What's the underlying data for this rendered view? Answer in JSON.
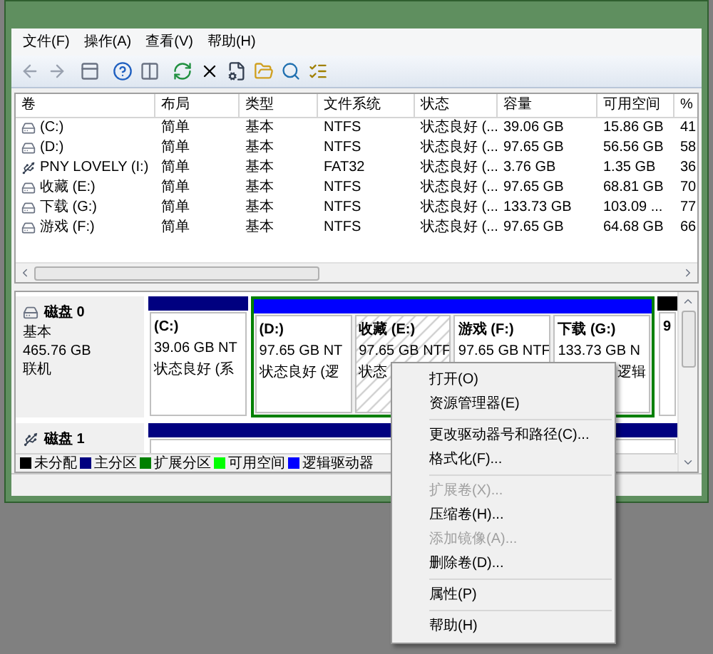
{
  "menu_bar": [
    {
      "label": "文件(F)"
    },
    {
      "label": "操作(A)"
    },
    {
      "label": "查看(V)"
    },
    {
      "label": "帮助(H)"
    }
  ],
  "volume_table": {
    "columns": [
      "卷",
      "布局",
      "类型",
      "文件系统",
      "状态",
      "容量",
      "可用空间",
      "%"
    ],
    "rows": [
      {
        "kind": "disk",
        "cells": [
          "(C:)",
          "简单",
          "基本",
          "NTFS",
          "状态良好 (...",
          "39.06 GB",
          "15.86 GB",
          "41"
        ]
      },
      {
        "kind": "disk",
        "cells": [
          "(D:)",
          "简单",
          "基本",
          "NTFS",
          "状态良好 (...",
          "97.65 GB",
          "56.56 GB",
          "58"
        ]
      },
      {
        "kind": "usb",
        "cells": [
          "PNY LOVELY (I:)",
          "简单",
          "基本",
          "FAT32",
          "状态良好 (...",
          "3.76 GB",
          "1.35 GB",
          "36"
        ]
      },
      {
        "kind": "disk",
        "cells": [
          "收藏 (E:)",
          "简单",
          "基本",
          "NTFS",
          "状态良好 (...",
          "97.65 GB",
          "68.81 GB",
          "70"
        ]
      },
      {
        "kind": "disk",
        "cells": [
          "下载 (G:)",
          "简单",
          "基本",
          "NTFS",
          "状态良好 (...",
          "133.73 GB",
          "103.09 ...",
          "77"
        ]
      },
      {
        "kind": "disk",
        "cells": [
          "游戏 (F:)",
          "简单",
          "基本",
          "NTFS",
          "状态良好 (...",
          "97.65 GB",
          "64.68 GB",
          "66"
        ]
      }
    ]
  },
  "disks": [
    {
      "name": "磁盘 0",
      "kind": "fixed",
      "type": "基本",
      "size": "465.76 GB",
      "status": "联机",
      "segments": [
        {
          "kind": "primary",
          "selected": false,
          "lines": [
            "(C:)",
            "39.06 GB NT",
            "状态良好 (系"
          ]
        },
        {
          "kind": "extended",
          "children": [
            {
              "kind": "logical",
              "selected": false,
              "lines": [
                "(D:)",
                "97.65 GB NT",
                "状态良好 (逻"
              ]
            },
            {
              "kind": "logical",
              "selected": true,
              "lines": [
                "收藏  (E:)",
                "97.65 GB NTF",
                "状态"
              ]
            },
            {
              "kind": "logical",
              "selected": false,
              "lines": [
                "游戏  (F:)",
                "97.65 GB NTF"
              ]
            },
            {
              "kind": "logical",
              "selected": false,
              "lines": [
                "下载  (G:)",
                "133.73 GB N",
                "逻辑"
              ]
            }
          ]
        },
        {
          "kind": "unallocated",
          "selected": false,
          "lines": [
            "9"
          ]
        }
      ]
    },
    {
      "name": "磁盘 1",
      "kind": "removable",
      "segments": [
        {
          "kind": "primary",
          "selected": false
        }
      ]
    }
  ],
  "legend": [
    {
      "label": "未分配",
      "color": "#000000"
    },
    {
      "label": "主分区",
      "color": "#000080"
    },
    {
      "label": "扩展分区",
      "color": "#008000"
    },
    {
      "label": "可用空间",
      "color": "#00ff00"
    },
    {
      "label": "逻辑驱动器",
      "color": "#0000ff"
    }
  ],
  "context_menu": [
    {
      "kind": "item",
      "label": "打开(O)",
      "disabled": false
    },
    {
      "kind": "item",
      "label": "资源管理器(E)",
      "disabled": false
    },
    {
      "kind": "separator"
    },
    {
      "kind": "item",
      "label": "更改驱动器号和路径(C)...",
      "disabled": false
    },
    {
      "kind": "item",
      "label": "格式化(F)...",
      "disabled": false
    },
    {
      "kind": "separator"
    },
    {
      "kind": "item",
      "label": "扩展卷(X)...",
      "disabled": true
    },
    {
      "kind": "item",
      "label": "压缩卷(H)...",
      "disabled": false
    },
    {
      "kind": "item",
      "label": "添加镜像(A)...",
      "disabled": true
    },
    {
      "kind": "item",
      "label": "删除卷(D)...",
      "disabled": false
    },
    {
      "kind": "separator"
    },
    {
      "kind": "item",
      "label": "属性(P)",
      "disabled": false
    },
    {
      "kind": "separator"
    },
    {
      "kind": "item",
      "label": "帮助(H)",
      "disabled": false
    }
  ]
}
